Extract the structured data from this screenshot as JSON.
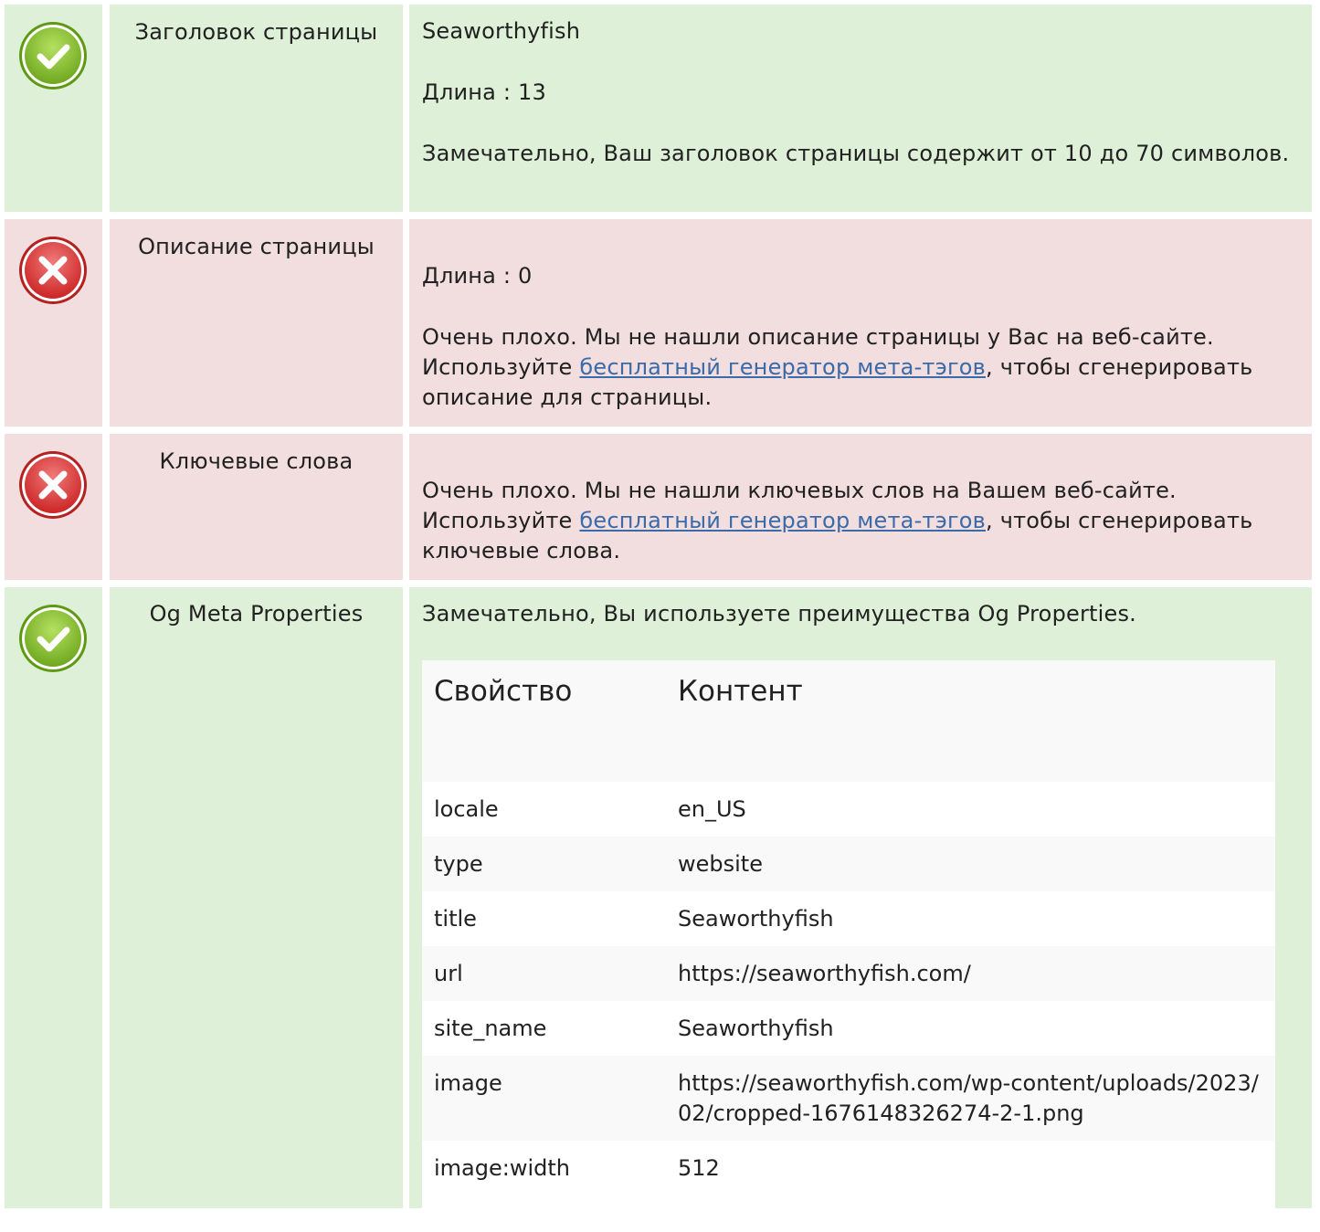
{
  "rows": {
    "title": {
      "label": "Заголовок страницы",
      "value": "Seaworthyfish",
      "length_line": "Длина : 13",
      "message": "Замечательно, Ваш заголовок страницы содержит от 10 до 70 символов."
    },
    "description": {
      "label": "Описание страницы",
      "length_line": "Длина : 0",
      "message_before": "Очень плохо. Мы не нашли описание страницы у Вас на веб-сайте. Используйте ",
      "link_text": "бесплатный генератор мета-тэгов",
      "message_after": ", чтобы сгенерировать описание для страницы."
    },
    "keywords": {
      "label": "Ключевые слова",
      "message_before": "Очень плохо. Мы не нашли ключевых слов на Вашем веб-сайте. Используйте ",
      "link_text": "бесплатный генератор мета-тэгов",
      "message_after": ", чтобы сгенерировать ключевые слова."
    },
    "og": {
      "label": "Og Meta Properties",
      "message": "Замечательно, Вы используете преимущества Og Properties.",
      "table_header": {
        "property": "Свойство",
        "content": "Контент"
      },
      "table_rows": [
        {
          "property": "locale",
          "content": "en_US"
        },
        {
          "property": "type",
          "content": "website"
        },
        {
          "property": "title",
          "content": "Seaworthyfish"
        },
        {
          "property": "url",
          "content": "https://seaworthyfish.com/"
        },
        {
          "property": "site_name",
          "content": "Seaworthyfish"
        },
        {
          "property": "image",
          "content": "https://seaworthyfish.com/wp-content/uploads/2023/02/cropped-1676148326274-2-1.png"
        },
        {
          "property": "image:width",
          "content": "512"
        }
      ]
    }
  },
  "icons": {
    "ok": "check-circle-icon",
    "bad": "x-circle-icon"
  },
  "colors": {
    "ok_bg": "#dff0d8",
    "bad_bg": "#f2dede",
    "ok_icon": "#8cc63f",
    "bad_icon": "#e03c3c",
    "link": "#3a6aa8"
  }
}
